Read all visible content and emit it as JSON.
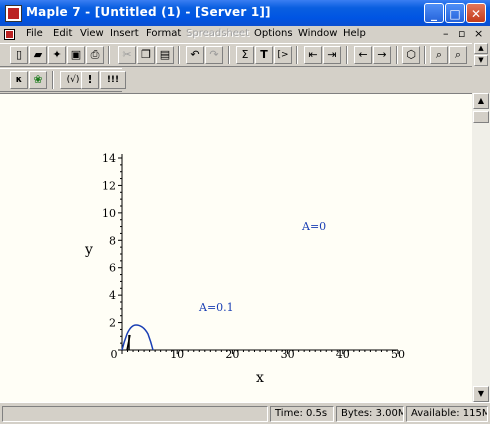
{
  "window": {
    "title": "Maple 7  - [Untitled (1) - [Server 1]]",
    "buttons": {
      "minimize": "_",
      "maximize": "□",
      "close": "✕"
    }
  },
  "menu": [
    {
      "label": "File",
      "disabled": false
    },
    {
      "label": "Edit",
      "disabled": false
    },
    {
      "label": "View",
      "disabled": false
    },
    {
      "label": "Insert",
      "disabled": false
    },
    {
      "label": "Format",
      "disabled": false
    },
    {
      "label": "Spreadsheet",
      "disabled": true
    },
    {
      "label": "Options",
      "disabled": false
    },
    {
      "label": "Window",
      "disabled": false
    },
    {
      "label": "Help",
      "disabled": false
    }
  ],
  "toolbar": {
    "sigma": "Σ",
    "text": "T",
    "prompt": "[>",
    "stop": "!",
    "execute_all": "!!!",
    "math_mode": "(√)"
  },
  "plot": {
    "x_ticks": [
      "0",
      "10",
      "20",
      "30",
      "40",
      "50"
    ],
    "y_ticks": [
      "2",
      "4",
      "6",
      "8",
      "10",
      "12",
      "14"
    ],
    "xlabel": "x",
    "ylabel": "y",
    "annotations": [
      "A=0",
      "A=0.1"
    ],
    "color": "#1a3fb4"
  },
  "status": {
    "time": "Time:   0.5s",
    "bytes": "Bytes: 3.00M",
    "available": "Available: 115M"
  }
}
